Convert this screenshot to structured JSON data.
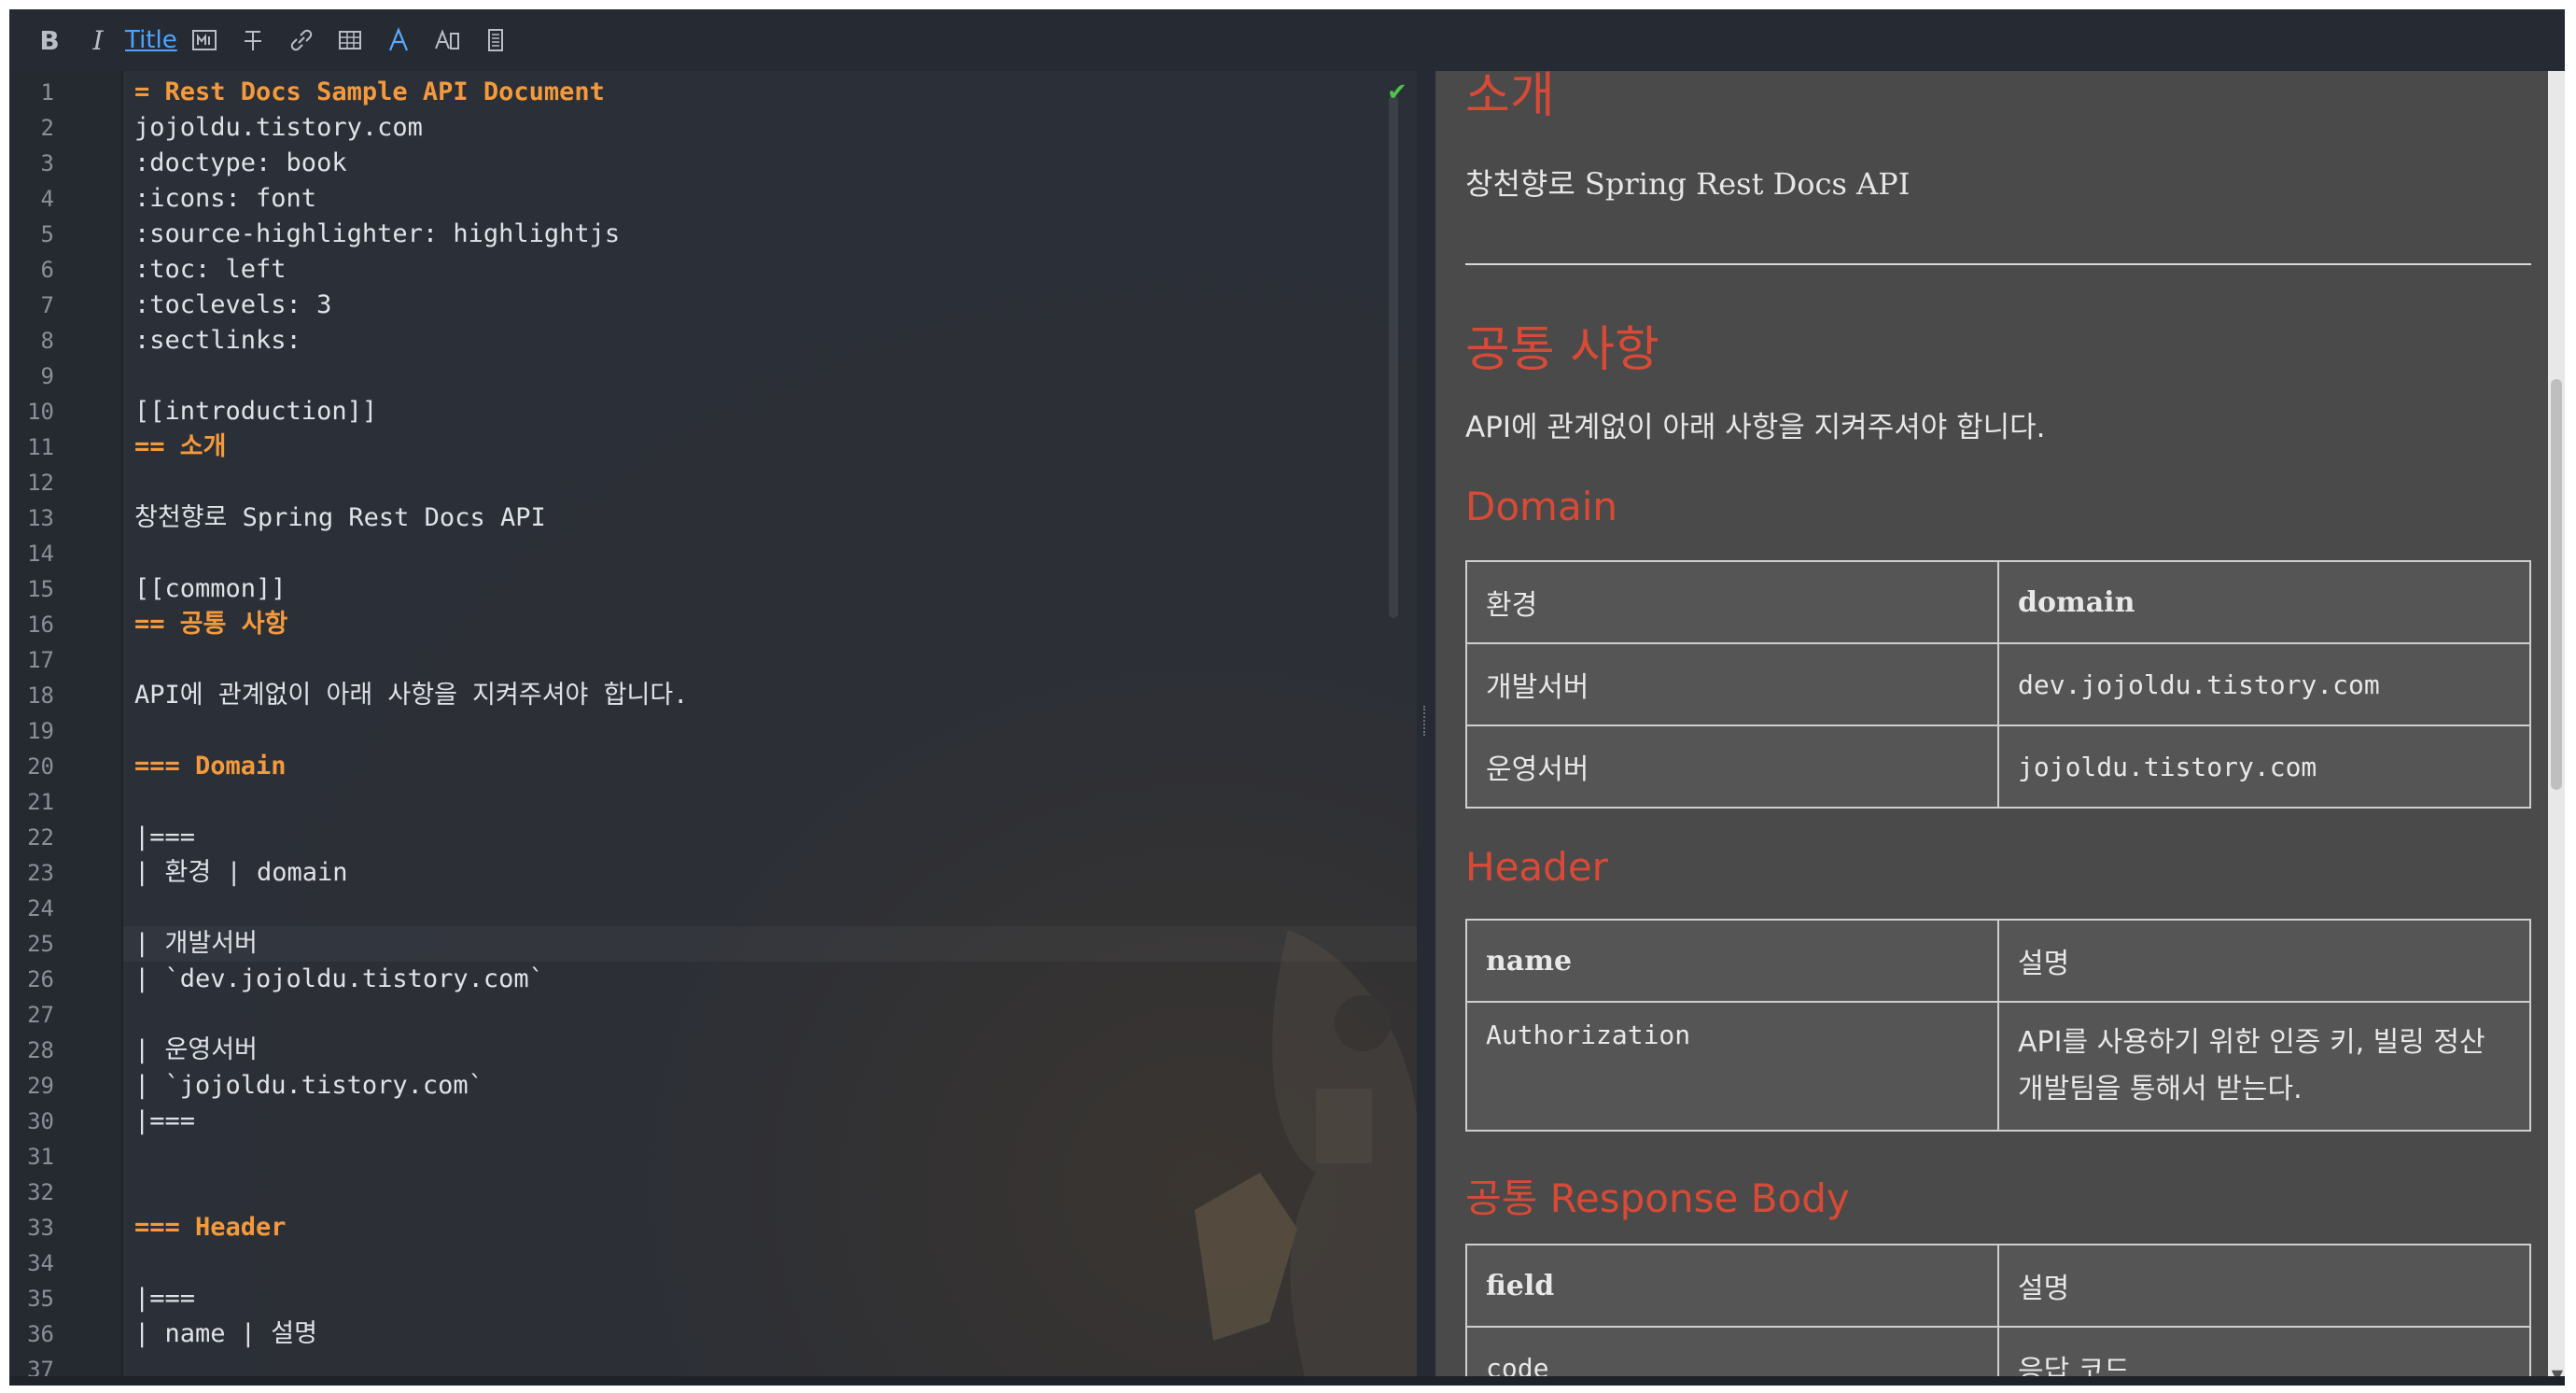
{
  "toolbar": {
    "bold": "B",
    "italic": "I",
    "title": "Title",
    "items": [
      "bold-icon",
      "italic-icon",
      "title",
      "monospace-icon",
      "strikethrough-icon",
      "link-icon",
      "table-icon",
      "font-icon",
      "font-style-icon",
      "document-icon"
    ]
  },
  "editor": {
    "lines": [
      "= Rest Docs Sample API Document",
      "jojoldu.tistory.com",
      ":doctype: book",
      ":icons: font",
      ":source-highlighter: highlightjs",
      ":toc: left",
      ":toclevels: 3",
      ":sectlinks:",
      "",
      "[[introduction]]",
      "== 소개",
      "",
      "창천향로 Spring Rest Docs API",
      "",
      "[[common]]",
      "== 공통 사항",
      "",
      "API에 관계없이 아래 사항을 지켜주셔야 합니다.",
      "",
      "=== Domain",
      "",
      "|===",
      "| 환경 | domain",
      "",
      "| 개발서버",
      "| `dev.jojoldu.tistory.com`",
      "",
      "| 운영서버",
      "| `jojoldu.tistory.com`",
      "|===",
      "",
      "",
      "=== Header",
      "",
      "|===",
      "| name | 설명",
      ""
    ],
    "line_numbers": [
      "1",
      "2",
      "3",
      "4",
      "5",
      "6",
      "7",
      "8",
      "9",
      "10",
      "11",
      "12",
      "13",
      "14",
      "15",
      "16",
      "17",
      "18",
      "19",
      "20",
      "21",
      "22",
      "23",
      "24",
      "25",
      "26",
      "27",
      "28",
      "29",
      "30",
      "31",
      "32",
      "33",
      "34",
      "35",
      "36",
      "37"
    ]
  },
  "preview": {
    "intro_heading": "소개",
    "intro_text": "창천향로 Spring Rest Docs API",
    "common_heading": "공통 사항",
    "common_text": "API에 관계없이 아래 사항을 지켜주셔야 합니다.",
    "domain_heading": "Domain",
    "domain_table": {
      "header": [
        "환경",
        "domain"
      ],
      "rows": [
        [
          "개발서버",
          "dev.jojoldu.tistory.com"
        ],
        [
          "운영서버",
          "jojoldu.tistory.com"
        ]
      ]
    },
    "header_heading": "Header",
    "header_table": {
      "header": [
        "name",
        "설명"
      ],
      "rows": [
        [
          "Authorization",
          "API를 사용하기 위한 인증 키, 빌링 정산 개발팀을 통해서 받는다."
        ]
      ]
    },
    "response_heading": "공통 Response Body",
    "response_table": {
      "header": [
        "field",
        "설명"
      ],
      "rows": [
        [
          "code",
          "응답 코드"
        ]
      ]
    }
  }
}
